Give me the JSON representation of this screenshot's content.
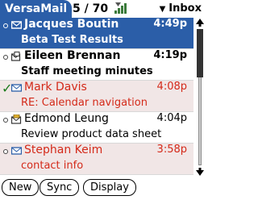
{
  "header": {
    "app_name": "VersaMail",
    "count": "5 / 70",
    "folder": "Inbox",
    "folder_arrow": "▼"
  },
  "messages": [
    {
      "sender": "Jacques Boutin",
      "time": "4:49p",
      "subject": "Beta Test Results",
      "state": "selected",
      "read": false,
      "icon": "envelope-icon"
    },
    {
      "sender": "Eileen Brennan",
      "time": "4:19p",
      "subject": "Staff meeting minutes",
      "state": "normal",
      "read": false,
      "icon": "envelope-attachment-icon"
    },
    {
      "sender": "Mark Davis",
      "time": "4:08p",
      "subject": "RE: Calendar navigation",
      "state": "pink",
      "read": true,
      "icon": "envelope-icon",
      "marker": "✓"
    },
    {
      "sender": "Edmond Leung",
      "time": "4:04p",
      "subject": "Review product data sheet",
      "state": "normal",
      "read": true,
      "icon": "envelope-priority-icon"
    },
    {
      "sender": "Stephan Keim",
      "time": "3:58p",
      "subject": "contact info",
      "state": "pink",
      "read": true,
      "icon": "envelope-icon"
    }
  ],
  "buttons": {
    "new": "New",
    "sync": "Sync",
    "display": "Display"
  },
  "colors": {
    "accent": "#2b5ea8",
    "unread_highlight": "#d42a1a",
    "pink_row": "#f1e6e6"
  }
}
